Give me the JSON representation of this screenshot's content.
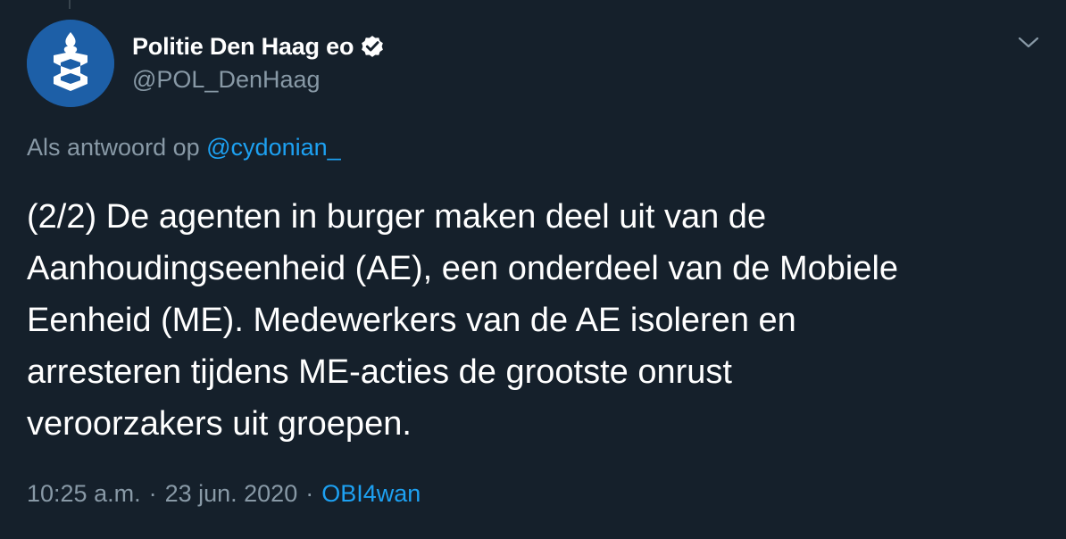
{
  "author": {
    "display_name": "Politie Den Haag eo",
    "handle": "@POL_DenHaag",
    "verified_icon": "verified-badge-icon",
    "avatar_icon": "police-logo-icon"
  },
  "reply_context": {
    "prefix": "Als antwoord op",
    "mention": "@cydonian_"
  },
  "tweet": {
    "lines": [
      "(2/2) De agenten in burger maken deel uit van de",
      "Aanhoudingseenheid (AE), een onderdeel van de Mobiele",
      "Eenheid (ME). Medewerkers van de AE isoleren en",
      "arresteren tijdens ME-acties de grootste onrust",
      "veroorzakers uit groepen."
    ]
  },
  "meta": {
    "time": "10:25 a.m.",
    "separator": "·",
    "date": "23 jun. 2020",
    "source": "OBI4wan"
  },
  "colors": {
    "background": "#15202b",
    "text": "#ffffff",
    "secondary": "#8899a6",
    "link": "#1da1f2",
    "avatar_bg": "#1d5fa7"
  },
  "icons": {
    "more": "chevron-down-icon"
  }
}
